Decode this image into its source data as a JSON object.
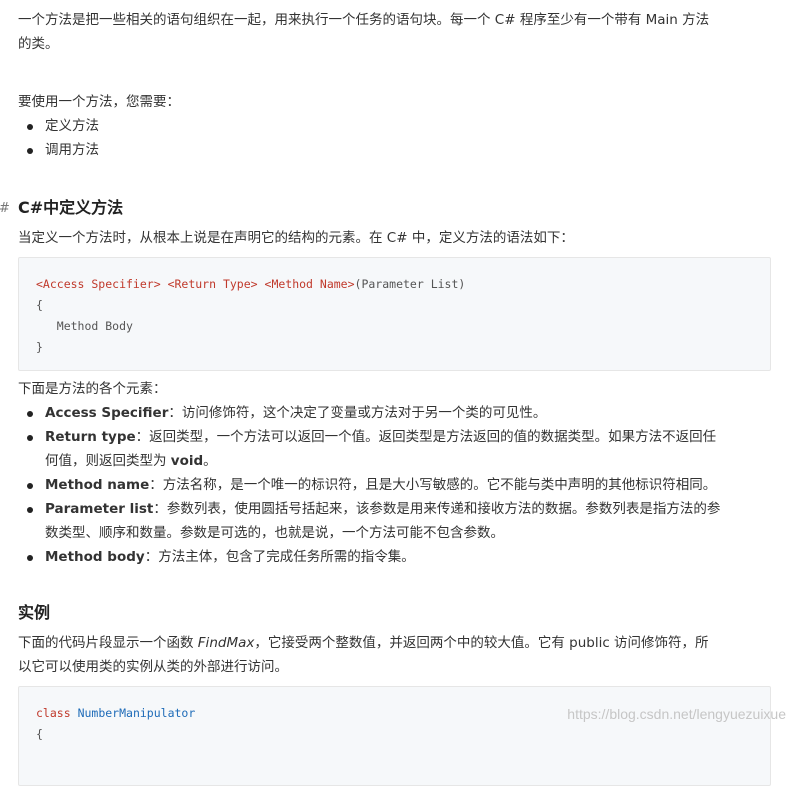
{
  "intro": {
    "line1": "一个方法是把一些相关的语句组织在一起，用来执行一个任务的语句块。每一个 C# 程序至少有一个带有 Main 方法",
    "line2": "的类。"
  },
  "need_text": "要使用一个方法，您需要：",
  "need_items": [
    "定义方法",
    "调用方法"
  ],
  "define_section": {
    "anchor": "#",
    "heading": "C#中定义方法",
    "desc": "当定义一个方法时，从根本上说是在声明它的结构的元素。在 C# 中，定义方法的语法如下：",
    "code": {
      "access": "<Access Specifier>",
      "return": "<Return Type>",
      "name": "<Method Name>",
      "params": "(Parameter List)",
      "open": "{",
      "body": "   Method Body",
      "close": "}"
    },
    "elements_intro": "下面是方法的各个元素：",
    "elements": [
      {
        "term": "Access Specifier",
        "desc": "：访问修饰符，这个决定了变量或方法对于另一个类的可见性。"
      },
      {
        "term": "Return type",
        "desc": "：返回类型，一个方法可以返回一个值。返回类型是方法返回的值的数据类型。如果方法不返回任",
        "desc2": "何值，则返回类型为 ",
        "term2": "void",
        "desc3": "。"
      },
      {
        "term": "Method name",
        "desc": "：方法名称，是一个唯一的标识符，且是大小写敏感的。它不能与类中声明的其他标识符相同。"
      },
      {
        "term": "Parameter list",
        "desc": "：参数列表，使用圆括号括起来，该参数是用来传递和接收方法的数据。参数列表是指方法的参",
        "desc2": "数类型、顺序和数量。参数是可选的，也就是说，一个方法可能不包含参数。"
      },
      {
        "term": "Method body",
        "desc": "：方法主体，包含了完成任务所需的指令集。"
      }
    ]
  },
  "example_section": {
    "heading": "实例",
    "desc_pre": "下面的代码片段显示一个函数 ",
    "func_name": "FindMax",
    "desc_post": "，它接受两个整数值，并返回两个中的较大值。它有 public 访问修饰符，所",
    "desc_line2": "以它可以使用类的实例从类的外部进行访问。",
    "code_keyword": "class",
    "code_class": "NumberManipulator",
    "code_open": "{"
  },
  "watermark": "https://blog.csdn.net/lengyuezuixue",
  "colors": {
    "text": "#333333",
    "code_tag": "#c0392b",
    "code_class": "#1e6bb8",
    "code_bg": "#f6f8fa"
  }
}
